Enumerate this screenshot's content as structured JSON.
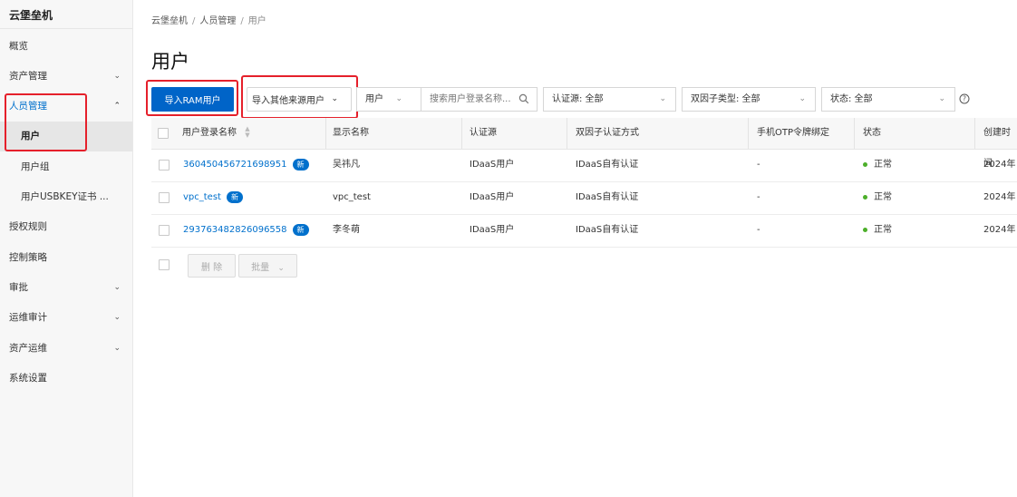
{
  "sidebar": {
    "brand": "云堡垒机",
    "items": [
      {
        "label": "概览"
      },
      {
        "label": "资产管理",
        "chevron": "chevron-down"
      },
      {
        "label": "人员管理",
        "chevron": "chevron-up"
      },
      {
        "label": "用户"
      },
      {
        "label": "用户组"
      },
      {
        "label": "用户USBKEY证书 ..."
      },
      {
        "label": "授权规则"
      },
      {
        "label": "控制策略"
      },
      {
        "label": "审批",
        "chevron": "chevron-down"
      },
      {
        "label": "运维审计",
        "chevron": "chevron-down"
      },
      {
        "label": "资产运维",
        "chevron": "chevron-down"
      },
      {
        "label": "系统设置"
      }
    ]
  },
  "breadcrumb": {
    "items": [
      "云堡垒机",
      "人员管理",
      "用户"
    ],
    "separator": "/"
  },
  "page": {
    "title": "用户"
  },
  "toolbar": {
    "import_ram": "导入RAM用户",
    "import_other": "导入其他来源用户",
    "search_type": "用户",
    "search_placeholder": "搜索用户登录名称...",
    "auth_source": "认证源: 全部",
    "twofa_type": "双因子类型: 全部",
    "status": "状态: 全部"
  },
  "table": {
    "headers": [
      "用户登录名称",
      "显示名称",
      "认证源",
      "双因子认证方式",
      "手机OTP令牌绑定",
      "状态",
      "创建时间"
    ],
    "rows": [
      {
        "login": "360450456721698951",
        "badge": "新",
        "display": "吴祎凡",
        "source": "IDaaS用户",
        "twofa": "IDaaS自有认证",
        "otp": "-",
        "status": "正常",
        "created": "2024年"
      },
      {
        "login": "vpc_test",
        "badge": "新",
        "display": "vpc_test",
        "source": "IDaaS用户",
        "twofa": "IDaaS自有认证",
        "otp": "-",
        "status": "正常",
        "created": "2024年"
      },
      {
        "login": "293763482826096558",
        "badge": "新",
        "display": "李冬萌",
        "source": "IDaaS用户",
        "twofa": "IDaaS自有认证",
        "otp": "-",
        "status": "正常",
        "created": "2024年"
      }
    ]
  },
  "footer": {
    "delete": "删 除",
    "batch": "批量"
  },
  "colors": {
    "primary": "#0064c8",
    "link": "#0070cc",
    "highlight": "#e5202b",
    "status_ok": "#4caf2a"
  }
}
